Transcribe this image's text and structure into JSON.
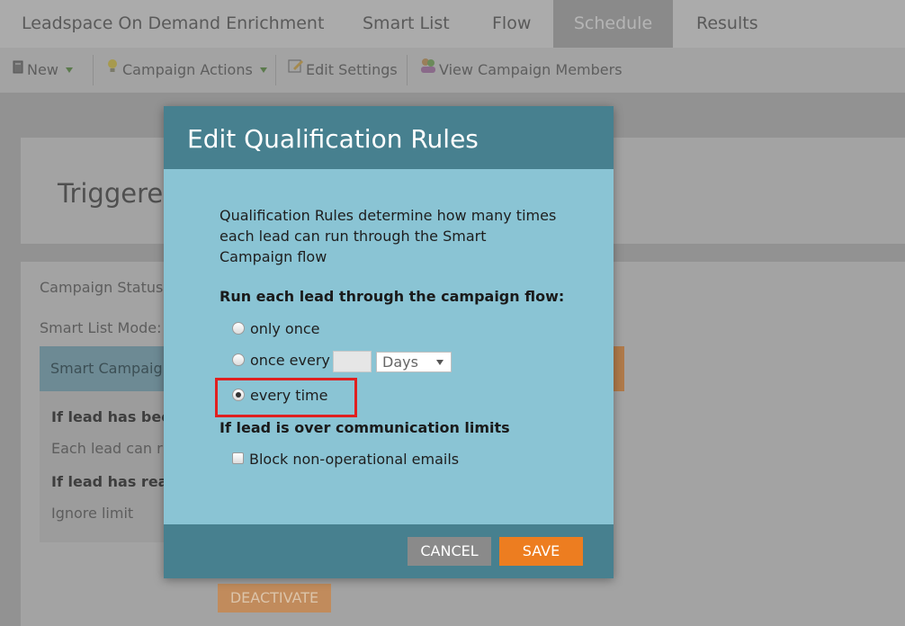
{
  "tabs": [
    {
      "label": "Leadspace On Demand Enrichment",
      "active": false
    },
    {
      "label": "Smart List",
      "active": false
    },
    {
      "label": "Flow",
      "active": false
    },
    {
      "label": "Schedule",
      "active": true
    },
    {
      "label": "Results",
      "active": false
    }
  ],
  "toolbar": {
    "new_label": "New",
    "campaign_actions_label": "Campaign Actions",
    "edit_settings_label": "Edit Settings",
    "view_members_label": "View Campaign Members"
  },
  "background": {
    "card_title": "Triggered",
    "campaign_status_label": "Campaign Status",
    "smart_list_mode_label": "Smart List Mode:",
    "smart_campaign_header": "Smart Campaig",
    "if_lead_has_been": "If lead has bee",
    "each_lead_can_run": "Each lead can ru",
    "if_lead_has_reached": "If lead has reac",
    "ignore_limit": "Ignore limit",
    "deactivate_label": "DEACTIVATE"
  },
  "modal": {
    "title": "Edit Qualification Rules",
    "description": "Qualification Rules determine how many times each lead can run through the Smart Campaign flow",
    "run_label": "Run each lead through the campaign flow:",
    "options": {
      "only_once": "only once",
      "once_every": "once every",
      "every_time": "every time"
    },
    "selected_option": "every_time",
    "once_every_value": "",
    "interval_unit": "Days",
    "limits_label": "If lead is over communication limits",
    "block_emails_label": "Block non-operational emails",
    "block_emails_checked": false,
    "cancel_label": "CANCEL",
    "save_label": "SAVE"
  },
  "colors": {
    "modal_header": "#47808f",
    "modal_body": "#8ac4d4",
    "save_button": "#ed7d20",
    "cancel_button": "#8a8a8a",
    "highlight_box": "#e02020"
  }
}
